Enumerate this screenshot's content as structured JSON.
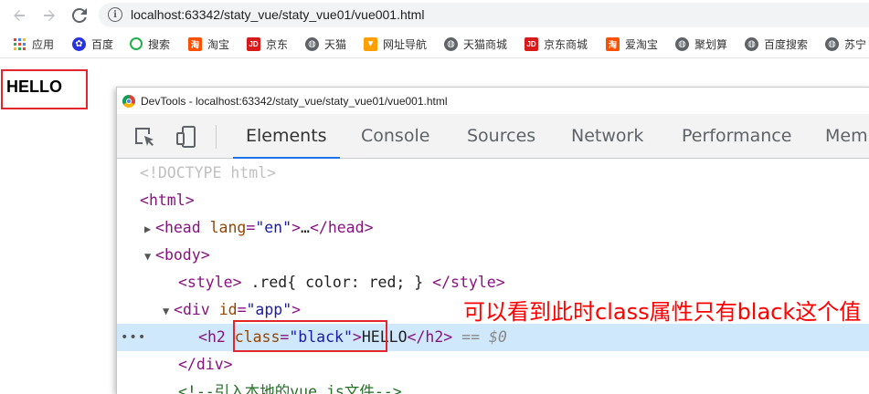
{
  "browser": {
    "url": "localhost:63342/staty_vue/staty_vue01/vue001.html",
    "back_icon": "back-arrow",
    "forward_icon": "forward-arrow",
    "reload_icon": "reload"
  },
  "bookmarks": [
    {
      "label": "应用",
      "icon": "apps-grid"
    },
    {
      "label": "百度",
      "icon": "baidu-paw"
    },
    {
      "label": "搜索",
      "icon": "search-q"
    },
    {
      "label": "淘宝",
      "icon": "taobao"
    },
    {
      "label": "京东",
      "icon": "jd"
    },
    {
      "label": "天猫",
      "icon": "globe"
    },
    {
      "label": "网址导航",
      "icon": "nav"
    },
    {
      "label": "天猫商城",
      "icon": "globe"
    },
    {
      "label": "京东商城",
      "icon": "jd"
    },
    {
      "label": "爱淘宝",
      "icon": "taobao"
    },
    {
      "label": "聚划算",
      "icon": "globe"
    },
    {
      "label": "百度搜索",
      "icon": "globe"
    },
    {
      "label": "苏宁",
      "icon": "globe"
    }
  ],
  "page": {
    "heading": "HELLO"
  },
  "devtools": {
    "title": "DevTools - localhost:63342/staty_vue/staty_vue01/vue001.html",
    "tabs": [
      "Elements",
      "Console",
      "Sources",
      "Network",
      "Performance",
      "Mem"
    ],
    "active_tab": "Elements",
    "lines": {
      "doctype": "<!DOCTYPE html>",
      "html_open": "html",
      "head_tag": "head",
      "head_attr": "lang",
      "head_val": "\"en\"",
      "head_ellipsis": "…",
      "body_tag": "body",
      "style_content": " .red{ color: red; } ",
      "div_tag": "div",
      "div_attr": "id",
      "div_val": "\"app\"",
      "h2_tag": "h2",
      "h2_attr": "class",
      "h2_val": "\"black\"",
      "h2_text": "HELLO",
      "h2_suffix": "== $0",
      "div_close": "</div>",
      "comment": "<!--引入本地的vue.js文件-->"
    }
  },
  "annotation": {
    "text": "可以看到此时class属性只有black这个值",
    "color": "#ff0000"
  }
}
